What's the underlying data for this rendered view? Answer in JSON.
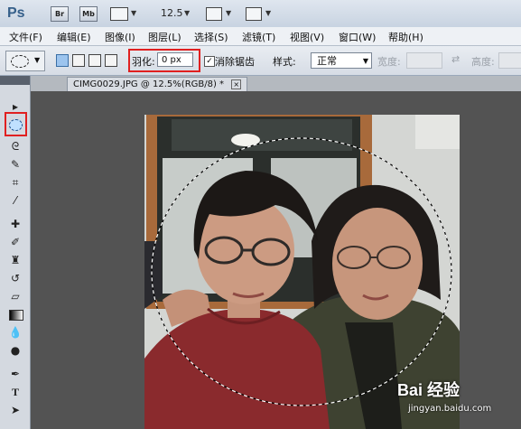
{
  "app": {
    "logo": "Ps",
    "bridge": "Br",
    "mini_bridge": "Mb",
    "zoom": "12.5"
  },
  "menu": [
    "文件(F)",
    "编辑(E)",
    "图像(I)",
    "图层(L)",
    "选择(S)",
    "滤镜(T)",
    "视图(V)",
    "窗口(W)",
    "帮助(H)"
  ],
  "options": {
    "feather_label": "羽化:",
    "feather_value": "0 px",
    "antialias_label": "消除锯齿",
    "antialias_checked": "✓",
    "style_label": "样式:",
    "style_value": "正常",
    "width_label": "宽度:",
    "height_label": "高度:"
  },
  "document": {
    "tab_title": "CIMG0029.JPG @ 12.5%(RGB/8) *",
    "close": "×"
  },
  "watermark": {
    "brand": "Bai 经验",
    "url": "jingyan.baidu.com"
  },
  "colors": {
    "highlight": "#e02020",
    "background": "#535353"
  }
}
